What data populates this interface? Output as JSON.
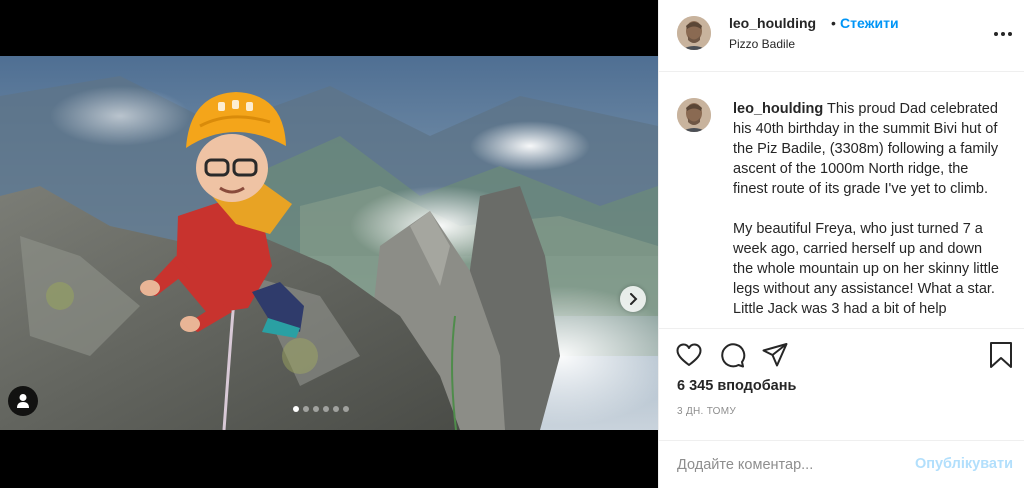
{
  "post": {
    "author": "leo_houlding",
    "follow_label": "Стежити",
    "separator": "•",
    "location": "Pizzo Badile",
    "caption": "This proud Dad celebrated his 40th birthday in the summit Bivi hut of the Piz Badile, (3308m) following a family ascent of the 1000m North ridge, the finest route of its grade I've yet to climb.\n\nMy beautiful Freya, who just turned 7 a week ago, carried herself up and down the whole mountain up on her skinny little legs without any assistance! What a star. Little Jack was 3 had a bit of help",
    "likes_text": "6 345 вподобань",
    "time_ago": "3 дн. тому",
    "comment_placeholder": "Додайте коментар...",
    "post_label": "Опублікувати"
  },
  "carousel": {
    "slide_count": 6,
    "active_index": 0
  },
  "colors": {
    "follow": "#0095f6",
    "post_disabled": "#b2dffc",
    "muted": "#8e8e8e",
    "text": "#262626"
  },
  "icons": {
    "like": "heart-icon",
    "comment": "comment-icon",
    "share": "share-icon",
    "save": "bookmark-icon",
    "more": "more-options-icon",
    "next": "chevron-right-icon",
    "tag": "user-tag-icon"
  }
}
